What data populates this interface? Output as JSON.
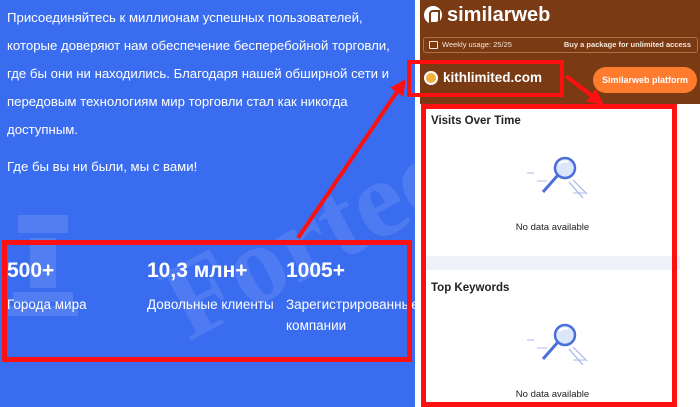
{
  "left_panel": {
    "paragraph1": "Присоединяйтесь к миллионам успешных пользователей, которые доверяют нам обеспечение бесперебойной торговли, где бы они ни находились. Благодаря нашей обширной сети и передовым технологиям мир торговли стал как никогда доступным.",
    "paragraph2": "Где бы вы ни были, мы с вами!",
    "stats": [
      {
        "number": "500+",
        "label": "Города мира"
      },
      {
        "number": "10,3 млн+",
        "label": "Довольные клиенты"
      },
      {
        "number": "1005+",
        "label": "Зарегистрированные компании"
      }
    ],
    "background_color": "#3a6cf0"
  },
  "similarweb_panel": {
    "brand": "similarweb",
    "usage_text": "Weekly usage: 25/25",
    "usage_cta": "Buy a package for unlimited access",
    "site_domain": "kithlimited.com",
    "platform_button": "Similarweb platform",
    "cards": [
      {
        "title": "Visits Over Time",
        "empty_text": "No data available",
        "icon": "magnifier-icon"
      },
      {
        "title": "Top Keywords",
        "empty_text": "No data available",
        "icon": "magnifier-icon"
      }
    ],
    "header_color": "#7a3a14",
    "button_color": "#ff7b2e"
  },
  "annotations": {
    "highlight_color": "#ff1010"
  },
  "watermark": "Forteck"
}
